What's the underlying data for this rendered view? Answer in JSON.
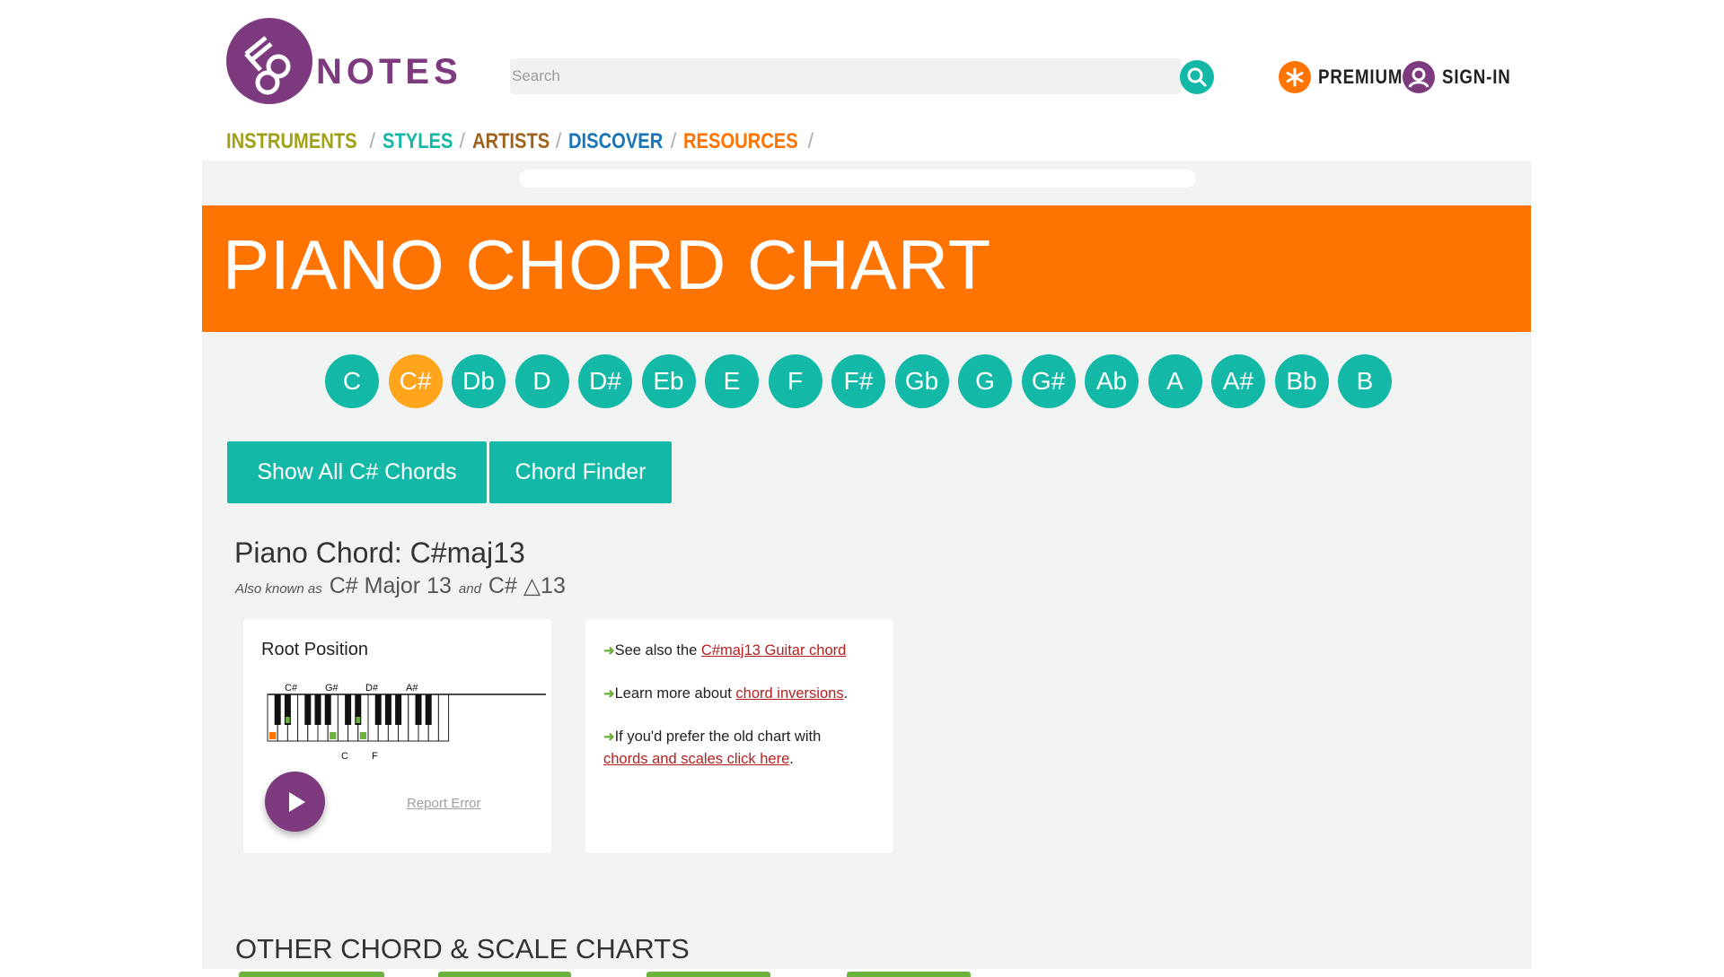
{
  "header": {
    "logo_word": "NOTES",
    "search_placeholder": "Search",
    "premium_label": "PREMIUM",
    "signin_label": "SIGN-IN",
    "brand_color": "#7d3a7e",
    "accent_color": "#14b8a6"
  },
  "nav": {
    "items": [
      {
        "label": "INSTRUMENTS",
        "color": "#a0a019"
      },
      {
        "label": "STYLES",
        "color": "#14b8a6"
      },
      {
        "label": "ARTISTS",
        "color": "#a0621e"
      },
      {
        "label": "DISCOVER",
        "color": "#1a75b8"
      },
      {
        "label": "RESOURCES",
        "color": "#ff7300"
      }
    ],
    "separator": "/"
  },
  "banner": {
    "title": "PIANO CHORD CHART",
    "color": "#ff7300"
  },
  "keys": {
    "items": [
      "C",
      "C#",
      "Db",
      "D",
      "D#",
      "Eb",
      "E",
      "F",
      "F#",
      "Gb",
      "G",
      "G#",
      "Ab",
      "A",
      "A#",
      "Bb",
      "B"
    ],
    "selected": "C#"
  },
  "buttons": {
    "show_all": "Show All C# Chords",
    "chord_finder": "Chord Finder"
  },
  "chord": {
    "heading": "Piano Chord: C#maj13",
    "aka_prefix": "Also known as",
    "aka_name1": "C# Major 13",
    "aka_and": "and",
    "aka_name2": "C# △13",
    "root_position_label": "Root Position",
    "keyboard_top_labels": [
      "C#",
      "G#",
      "D#",
      "A#"
    ],
    "keyboard_bottom_labels": [
      "C",
      "F"
    ],
    "report_error": "Report Error"
  },
  "info": {
    "line1_prefix": "See also the ",
    "line1_link": "C#maj13 Guitar chord",
    "line2_prefix": "Learn more about ",
    "line2_link": "chord inversions",
    "line2_suffix": ".",
    "line3_prefix": "If you'd prefer the old chart with",
    "line3_link": "chords and scales click here",
    "line3_suffix": "."
  },
  "other": {
    "heading": "OTHER CHORD & SCALE CHARTS"
  }
}
